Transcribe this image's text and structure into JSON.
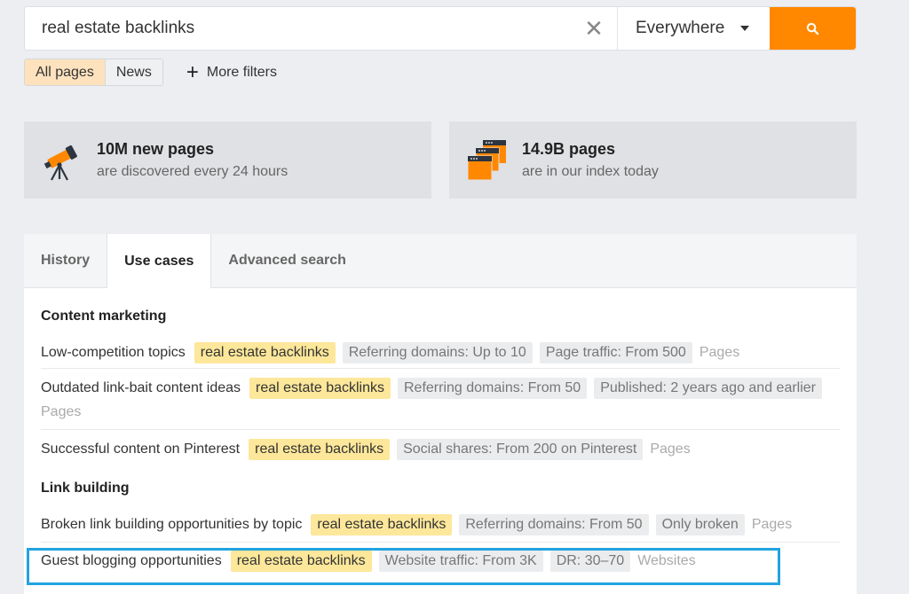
{
  "search": {
    "query": "real estate backlinks",
    "scope": "Everywhere",
    "clear_icon": "close-icon",
    "search_icon": "search-icon",
    "accent_color": "#ff8800"
  },
  "filters": {
    "tabs": [
      {
        "label": "All pages",
        "active": true
      },
      {
        "label": "News",
        "active": false
      }
    ],
    "more_filters": "More filters"
  },
  "stats": [
    {
      "icon": "telescope-icon",
      "title": "10M new pages",
      "subtitle": "are discovered every 24 hours"
    },
    {
      "icon": "browser-windows-icon",
      "title": "14.9B pages",
      "subtitle": "are in our index today"
    }
  ],
  "panel": {
    "tabs": [
      {
        "label": "History",
        "active": false
      },
      {
        "label": "Use cases",
        "active": true
      },
      {
        "label": "Advanced search",
        "active": false
      }
    ],
    "sections": [
      {
        "title": "Content marketing",
        "items": [
          {
            "label": "Low-competition topics",
            "keyword": "real estate backlinks",
            "filters": [
              "Referring domains: Up to 10",
              "Page traffic: From 500"
            ],
            "target": "Pages"
          },
          {
            "label": "Outdated link-bait content ideas",
            "keyword": "real estate backlinks",
            "filters": [
              "Referring domains: From 50",
              "Published: 2 years ago and earlier"
            ],
            "target": "Pages"
          },
          {
            "label": "Successful content on Pinterest",
            "keyword": "real estate backlinks",
            "filters": [
              "Social shares: From 200 on Pinterest"
            ],
            "target": "Pages"
          }
        ]
      },
      {
        "title": "Link building",
        "items": [
          {
            "label": "Broken link building opportunities by topic",
            "keyword": "real estate backlinks",
            "filters": [
              "Referring domains: From 50",
              "Only broken"
            ],
            "target": "Pages"
          },
          {
            "label": "Guest blogging opportunities",
            "keyword": "real estate backlinks",
            "filters": [
              "Website traffic: From 3K",
              "DR: 30–70"
            ],
            "target": "Websites"
          }
        ]
      }
    ]
  },
  "highlight_color": "#22a3e0"
}
